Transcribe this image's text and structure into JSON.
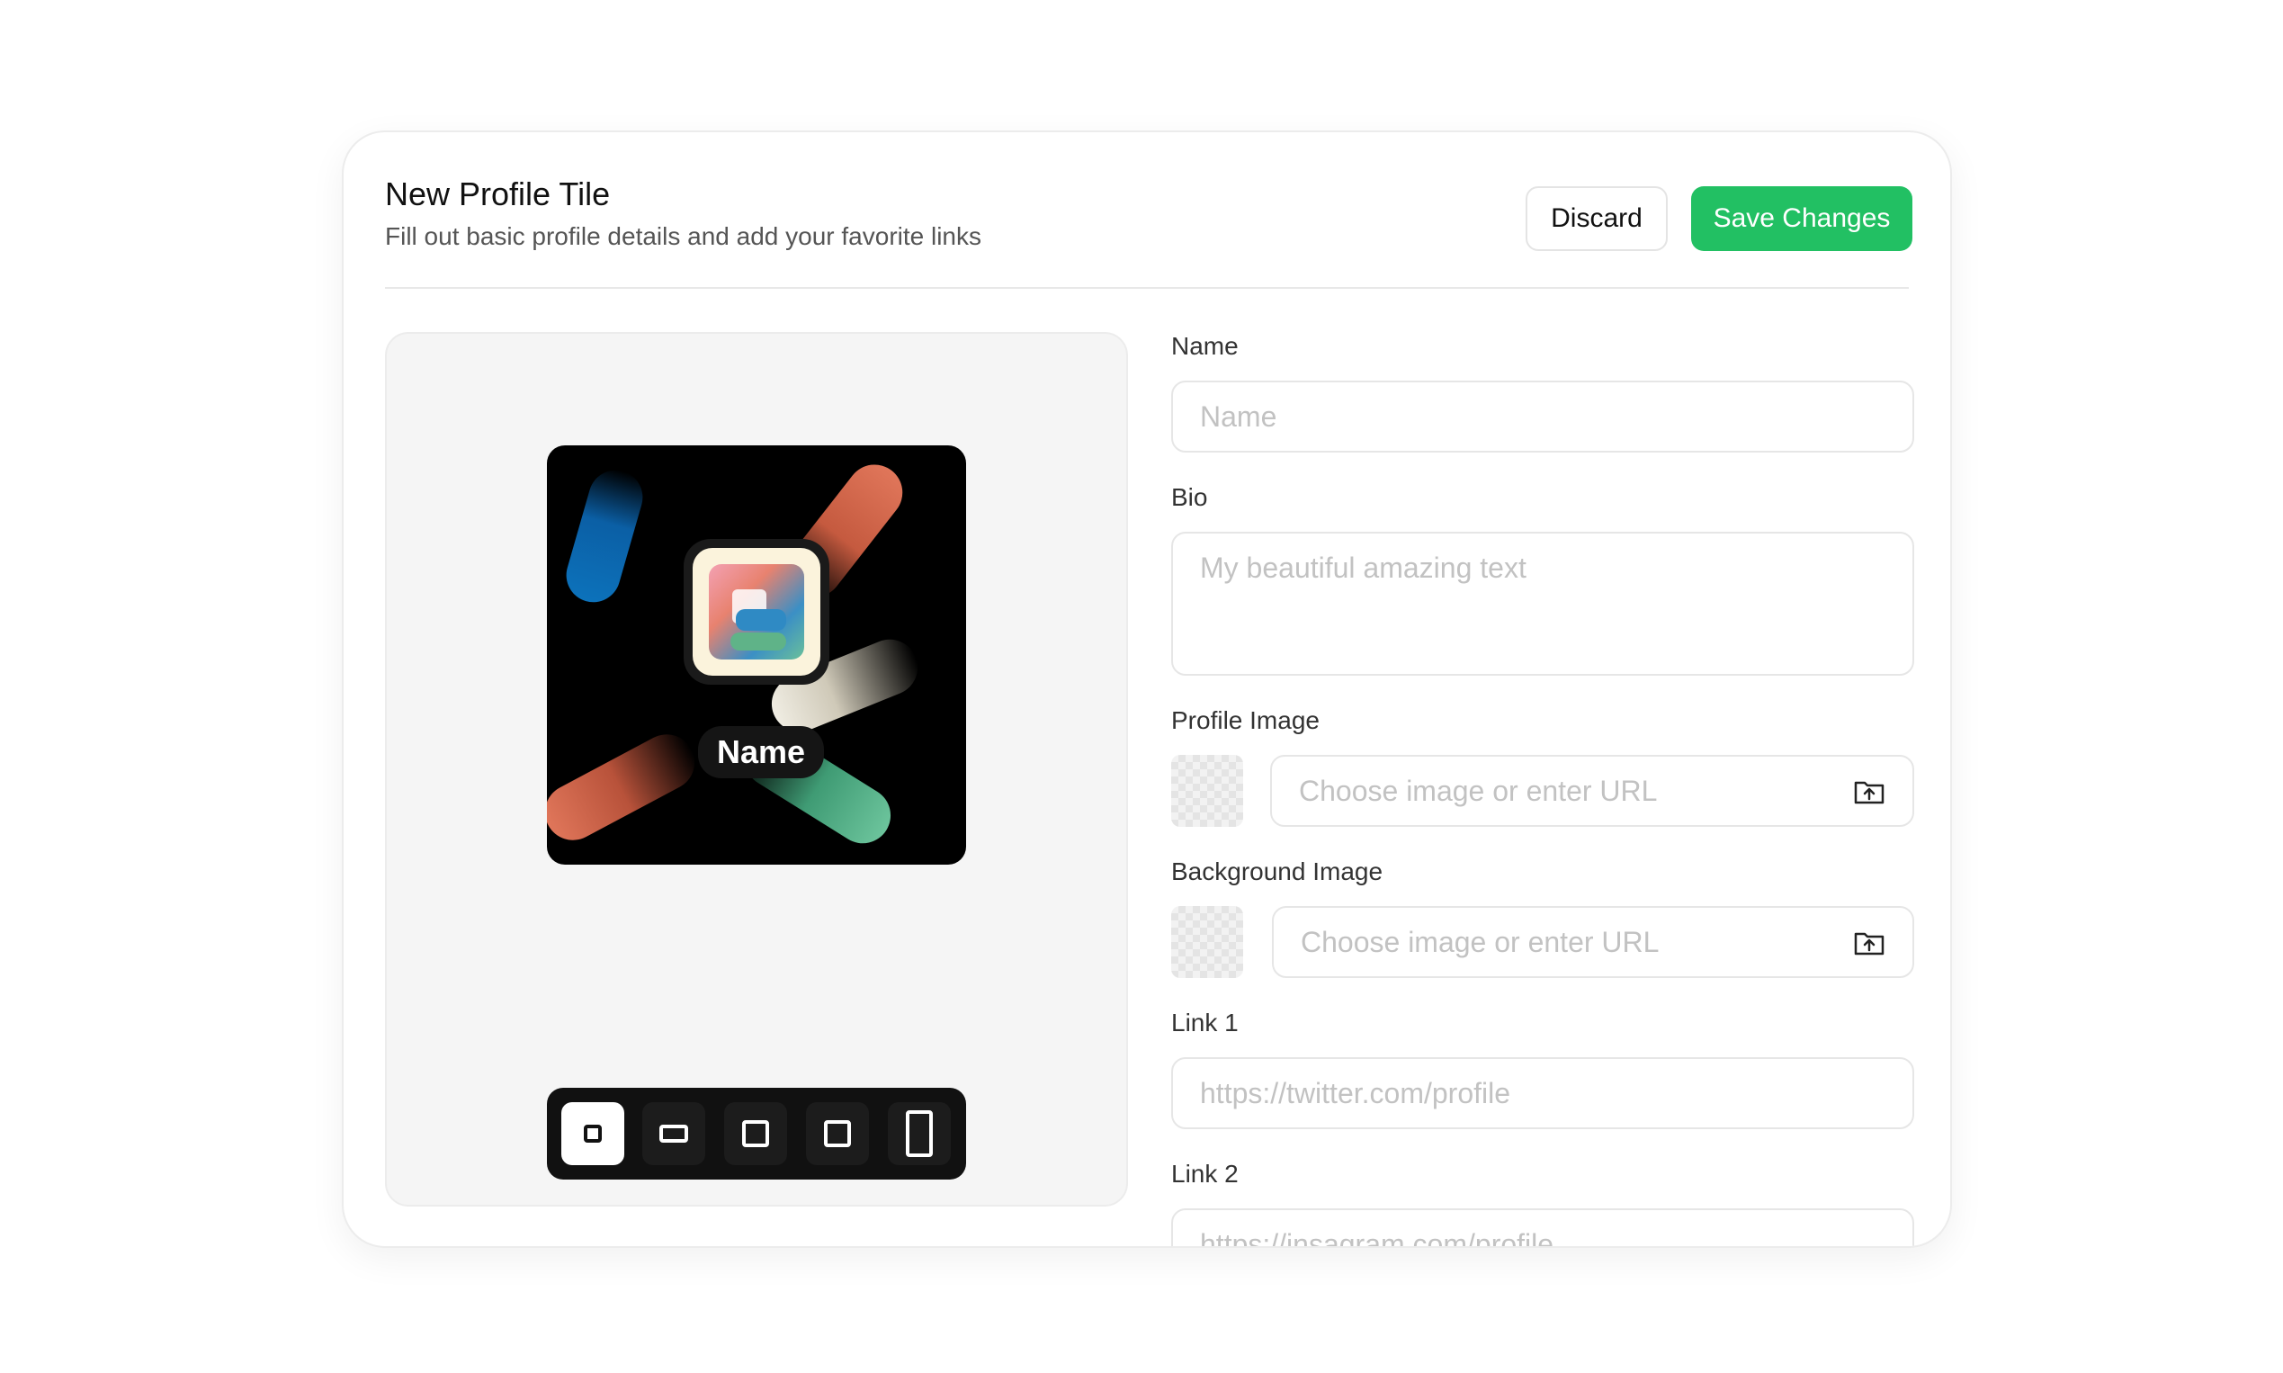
{
  "header": {
    "title": "New Profile Tile",
    "subtitle": "Fill out basic profile details and add your favorite links",
    "discard_label": "Discard",
    "save_label": "Save Changes"
  },
  "preview": {
    "name_badge": "Name",
    "size_options": [
      "size-small",
      "size-wide",
      "size-medium",
      "size-large",
      "size-tall"
    ],
    "selected_size": "size-small"
  },
  "form": {
    "name": {
      "label": "Name",
      "placeholder": "Name"
    },
    "bio": {
      "label": "Bio",
      "placeholder": "My beautiful amazing text"
    },
    "profile_image": {
      "label": "Profile Image",
      "placeholder": "Choose image or enter URL"
    },
    "background_image": {
      "label": "Background Image",
      "placeholder": "Choose image or enter URL"
    },
    "link1": {
      "label": "Link 1",
      "placeholder": "https://twitter.com/profile"
    },
    "link2": {
      "label": "Link 2",
      "placeholder": "https://insagram.com/profile"
    }
  },
  "colors": {
    "accent": "#22c063",
    "tile_bg": "#000000"
  }
}
